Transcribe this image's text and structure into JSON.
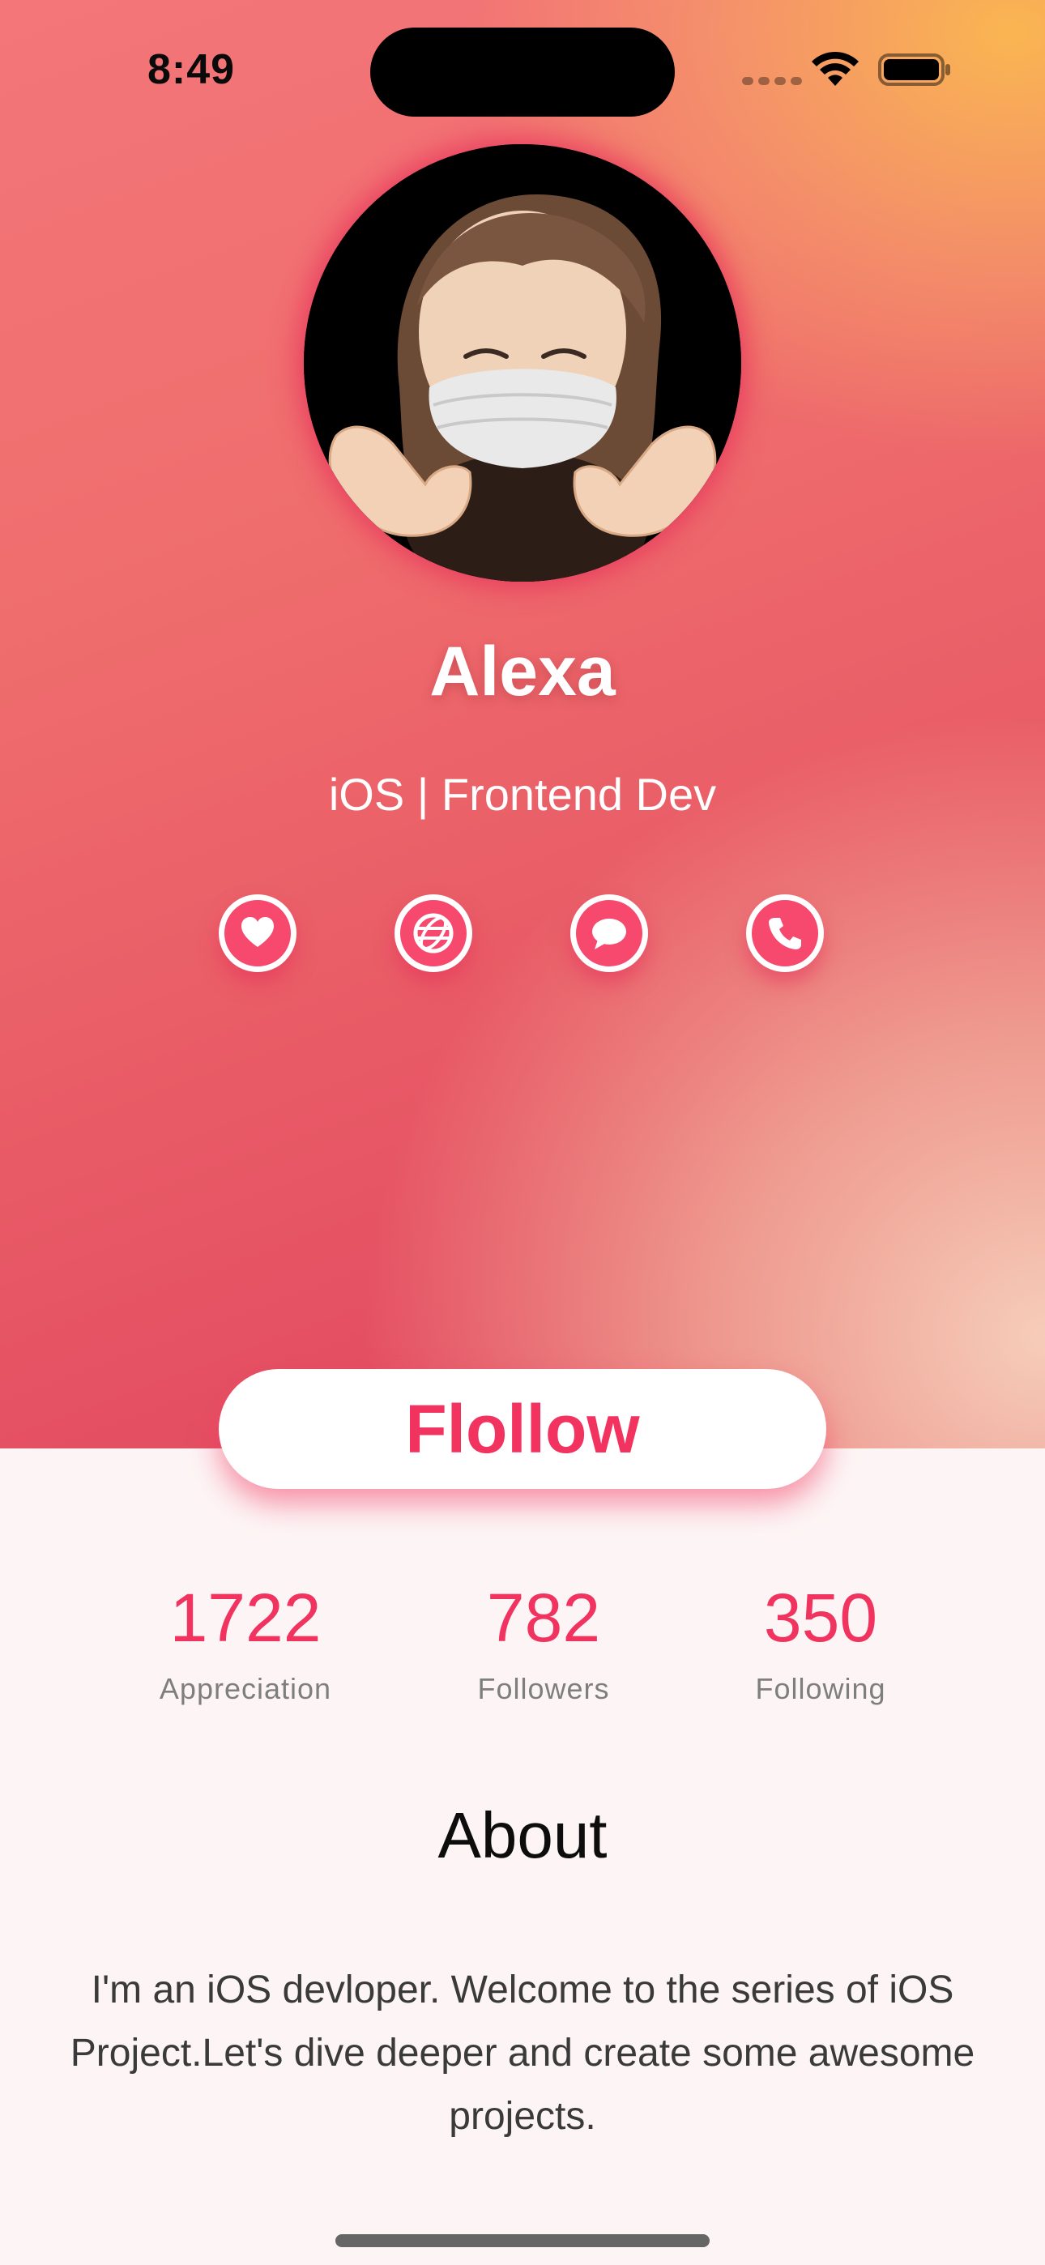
{
  "status_bar": {
    "time": "8:49"
  },
  "profile": {
    "name": "Alexa",
    "subtitle": "iOS | Frontend Dev"
  },
  "social_icons": [
    "heart-icon",
    "globe-icon",
    "message-icon",
    "phone-icon"
  ],
  "follow_button": {
    "label": "Flollow"
  },
  "stats": [
    {
      "value": "1722",
      "label": "Appreciation"
    },
    {
      "value": "782",
      "label": "Followers"
    },
    {
      "value": "350",
      "label": "Following"
    }
  ],
  "about": {
    "title": "About",
    "text": "I'm an iOS devloper. Welcome to the series of iOS Project.Let's dive deeper and create some awesome projects."
  },
  "colors": {
    "accent": "#f2325f",
    "header_start": "#f47679",
    "header_end": "#fab550",
    "background": "#fdf5f5"
  }
}
